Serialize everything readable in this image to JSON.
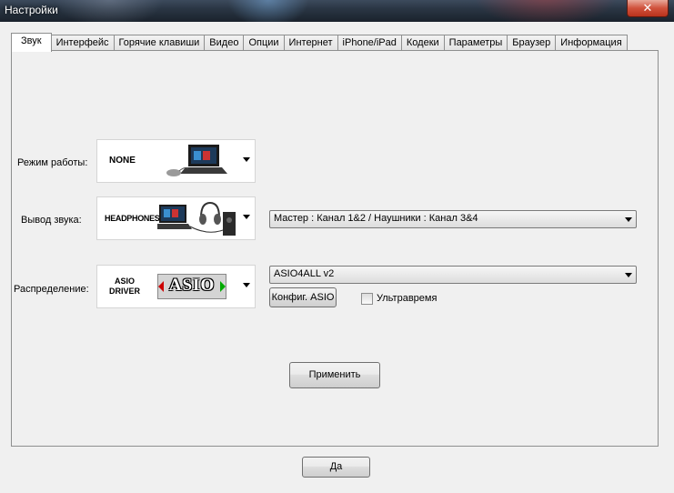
{
  "window": {
    "title": "Настройки",
    "close_glyph": "✕"
  },
  "tabs": [
    {
      "label": "Звук"
    },
    {
      "label": "Интерфейс"
    },
    {
      "label": "Горячие клавиши"
    },
    {
      "label": "Видео"
    },
    {
      "label": "Опции"
    },
    {
      "label": "Интернет"
    },
    {
      "label": "iPhone/iPad"
    },
    {
      "label": "Кодеки"
    },
    {
      "label": "Параметры"
    },
    {
      "label": "Браузер"
    },
    {
      "label": "Информация"
    }
  ],
  "sound": {
    "mode": {
      "label": "Режим работы:",
      "value_caption": "NONE"
    },
    "output": {
      "label": "Вывод звука:",
      "value_caption": "HEADPHONES",
      "routing_value": "Мастер : Канал 1&2 / Наушники : Канал 3&4"
    },
    "distribution": {
      "label": "Распределение:",
      "caption_line1": "ASIO",
      "caption_line2": "DRIVER",
      "logo_text": "ASIO",
      "driver_value": "ASIO4ALL v2",
      "config_button": "Конфиг. ASIO",
      "ultralatency_label": "Ультравремя",
      "ultralatency_checked": false
    },
    "apply_button": "Применить"
  },
  "footer": {
    "ok_button": "Да"
  }
}
